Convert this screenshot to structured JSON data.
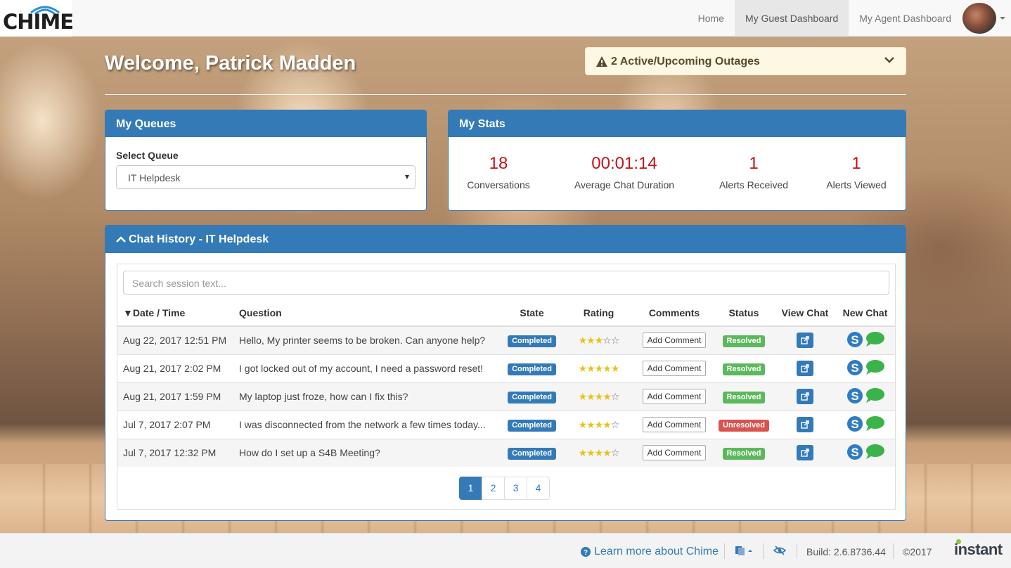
{
  "app": {
    "logo_text": "CHIME"
  },
  "nav": {
    "items": [
      {
        "label": "Home",
        "active": false
      },
      {
        "label": "My Guest Dashboard",
        "active": true
      },
      {
        "label": "My Agent Dashboard",
        "active": false
      }
    ]
  },
  "welcome": "Welcome, Patrick Madden",
  "outage": {
    "text": "2 Active/Upcoming Outages",
    "icon": "warning-icon"
  },
  "queues": {
    "title": "My Queues",
    "label": "Select Queue",
    "selected": "IT Helpdesk"
  },
  "stats": {
    "title": "My Stats",
    "items": [
      {
        "value": "18",
        "label": "Conversations"
      },
      {
        "value": "00:01:14",
        "label": "Average Chat Duration"
      },
      {
        "value": "1",
        "label": "Alerts Received"
      },
      {
        "value": "1",
        "label": "Alerts Viewed"
      }
    ]
  },
  "history": {
    "title": "Chat History - IT Helpdesk",
    "search_placeholder": "Search session text...",
    "columns": [
      "▼Date / Time",
      "Question",
      "State",
      "Rating",
      "Comments",
      "Status",
      "View Chat",
      "New Chat"
    ],
    "add_comment_label": "Add Comment",
    "rows": [
      {
        "date": "Aug 22, 2017 12:51 PM",
        "question": "Hello, My printer seems to be broken. Can anyone help?",
        "state": "Completed",
        "rating": 3,
        "status": "Resolved"
      },
      {
        "date": "Aug 21, 2017 2:02 PM",
        "question": "I got locked out of my account, I need a password reset!",
        "state": "Completed",
        "rating": 5,
        "status": "Resolved"
      },
      {
        "date": "Aug 21, 2017 1:59 PM",
        "question": "My laptop just froze, how can I fix this?",
        "state": "Completed",
        "rating": 4,
        "status": "Resolved"
      },
      {
        "date": "Jul 7, 2017 2:07 PM",
        "question": "I was disconnected from the network a few times today...",
        "state": "Completed",
        "rating": 4,
        "status": "Unresolved"
      },
      {
        "date": "Jul 7, 2017 12:32 PM",
        "question": "How do I set up a S4B Meeting?",
        "state": "Completed",
        "rating": 4,
        "status": "Resolved"
      }
    ],
    "pages": [
      "1",
      "2",
      "3",
      "4"
    ],
    "current_page": "1"
  },
  "footer": {
    "learn_more": "Learn more about Chime",
    "build": "Build: 2.6.8736.44",
    "copyright": "©2017",
    "brand": "instant"
  },
  "colors": {
    "primary": "#337ab7",
    "success": "#5cb85c",
    "danger": "#d9534f",
    "stat_value": "#c0141a",
    "star": "#e8c21a"
  }
}
